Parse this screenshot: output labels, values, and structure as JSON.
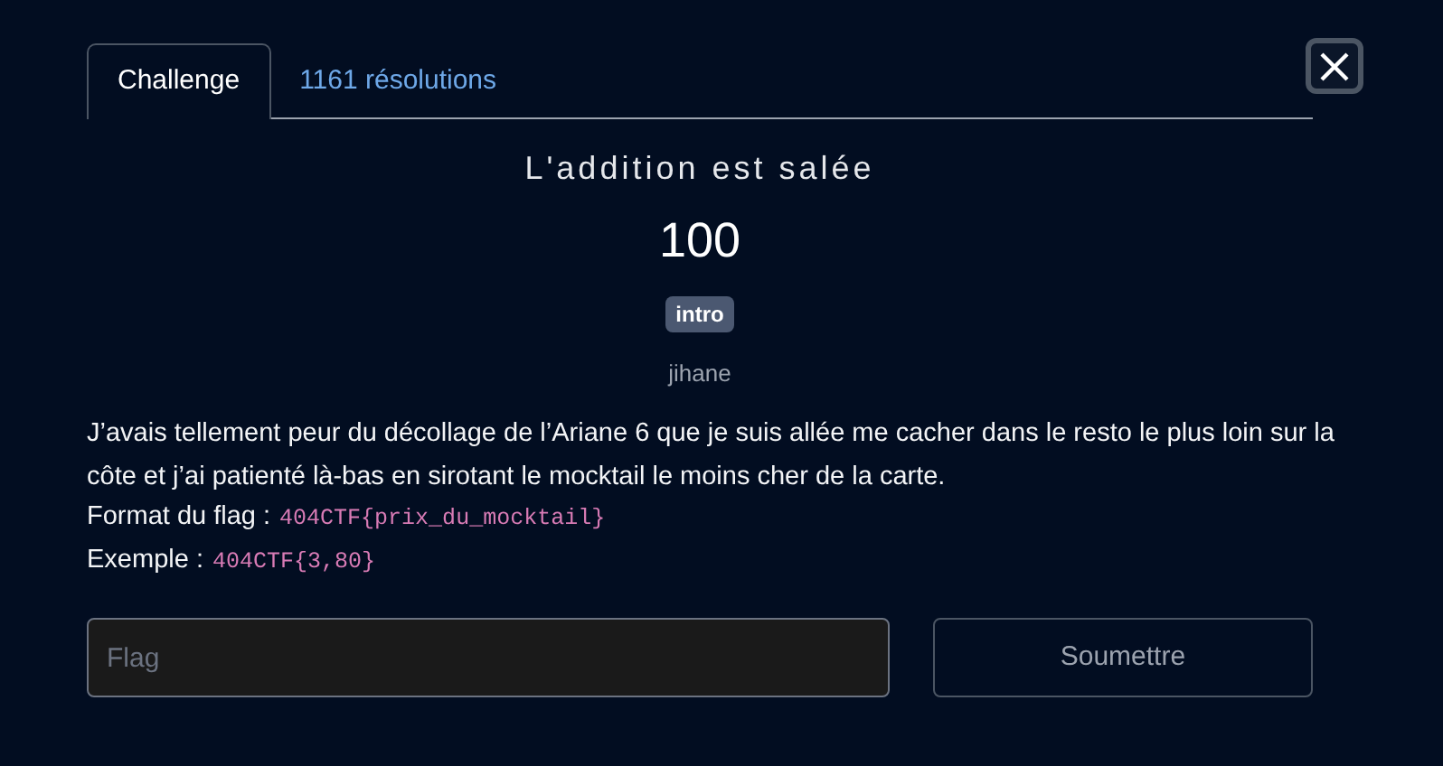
{
  "tabs": [
    {
      "label": "Challenge",
      "selected": true
    },
    {
      "label": "1161 résolutions",
      "selected": false
    }
  ],
  "challenge": {
    "title": "L'addition est salée",
    "points": "100",
    "tag": "intro",
    "author": "jihane",
    "description": "J’avais tellement peur du décollage de l’Ariane 6 que je suis allée me cacher dans le resto le plus loin sur la côte et j’ai patienté là-bas en sirotant le mocktail le moins cher de la carte.",
    "lines": [
      {
        "label": "Format du flag :",
        "code": "404CTF{prix_du_mocktail}"
      },
      {
        "label": "Exemple :",
        "code": "404CTF{3,80}"
      }
    ]
  },
  "form": {
    "placeholder": "Flag",
    "submit": "Soumettre"
  }
}
